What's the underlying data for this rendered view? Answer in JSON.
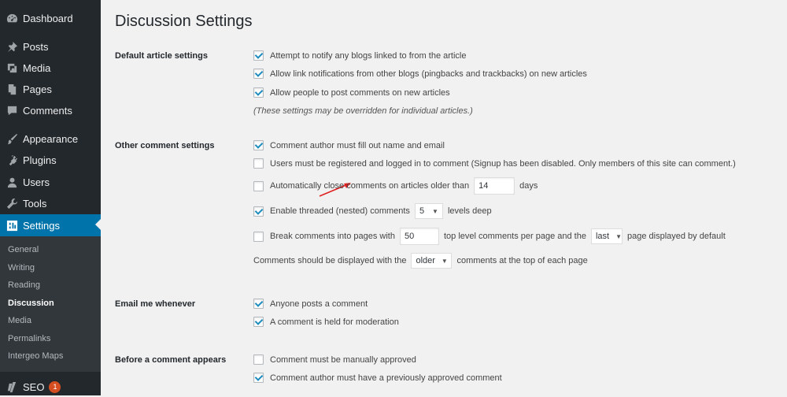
{
  "sidebar": {
    "items": [
      {
        "label": "Dashboard",
        "icon": "dashboard-icon"
      },
      {
        "label": "Posts",
        "icon": "pin-icon"
      },
      {
        "label": "Media",
        "icon": "media-icon"
      },
      {
        "label": "Pages",
        "icon": "pages-icon"
      },
      {
        "label": "Comments",
        "icon": "comment-icon"
      },
      {
        "label": "Appearance",
        "icon": "brush-icon"
      },
      {
        "label": "Plugins",
        "icon": "plug-icon"
      },
      {
        "label": "Users",
        "icon": "user-icon"
      },
      {
        "label": "Tools",
        "icon": "wrench-icon"
      },
      {
        "label": "Settings",
        "icon": "settings-icon"
      }
    ],
    "submenu": [
      "General",
      "Writing",
      "Reading",
      "Discussion",
      "Media",
      "Permalinks",
      "Intergeo Maps"
    ],
    "seo": {
      "label": "SEO",
      "badge": "1",
      "icon": "yoast-icon"
    }
  },
  "page": {
    "title": "Discussion Settings",
    "default_article": {
      "label": "Default article settings",
      "opt1": "Attempt to notify any blogs linked to from the article",
      "opt2": "Allow link notifications from other blogs (pingbacks and trackbacks) on new articles",
      "opt3": "Allow people to post comments on new articles",
      "note": "(These settings may be overridden for individual articles.)"
    },
    "other_comment": {
      "label": "Other comment settings",
      "opt1": "Comment author must fill out name and email",
      "opt2": "Users must be registered and logged in to comment (Signup has been disabled. Only members of this site can comment.)",
      "opt3_pre": "Automatically close comments on articles older than",
      "opt3_value": "14",
      "opt3_post": "days",
      "opt4_pre": "Enable threaded (nested) comments",
      "opt4_value": "5",
      "opt4_post": "levels deep",
      "opt5_pre": "Break comments into pages with",
      "opt5_value": "50",
      "opt5_mid": "top level comments per page and the",
      "opt5_select": "last",
      "opt5_post": "page displayed by default",
      "opt6_pre": "Comments should be displayed with the",
      "opt6_select": "older",
      "opt6_post": "comments at the top of each page"
    },
    "email_me": {
      "label": "Email me whenever",
      "opt1": "Anyone posts a comment",
      "opt2": "A comment is held for moderation"
    },
    "before_appears": {
      "label": "Before a comment appears",
      "opt1": "Comment must be manually approved",
      "opt2": "Comment author must have a previously approved comment"
    }
  },
  "colors": {
    "accent": "#0073aa",
    "sidebar": "#23282d",
    "annotation_arrow": "#e02020"
  }
}
